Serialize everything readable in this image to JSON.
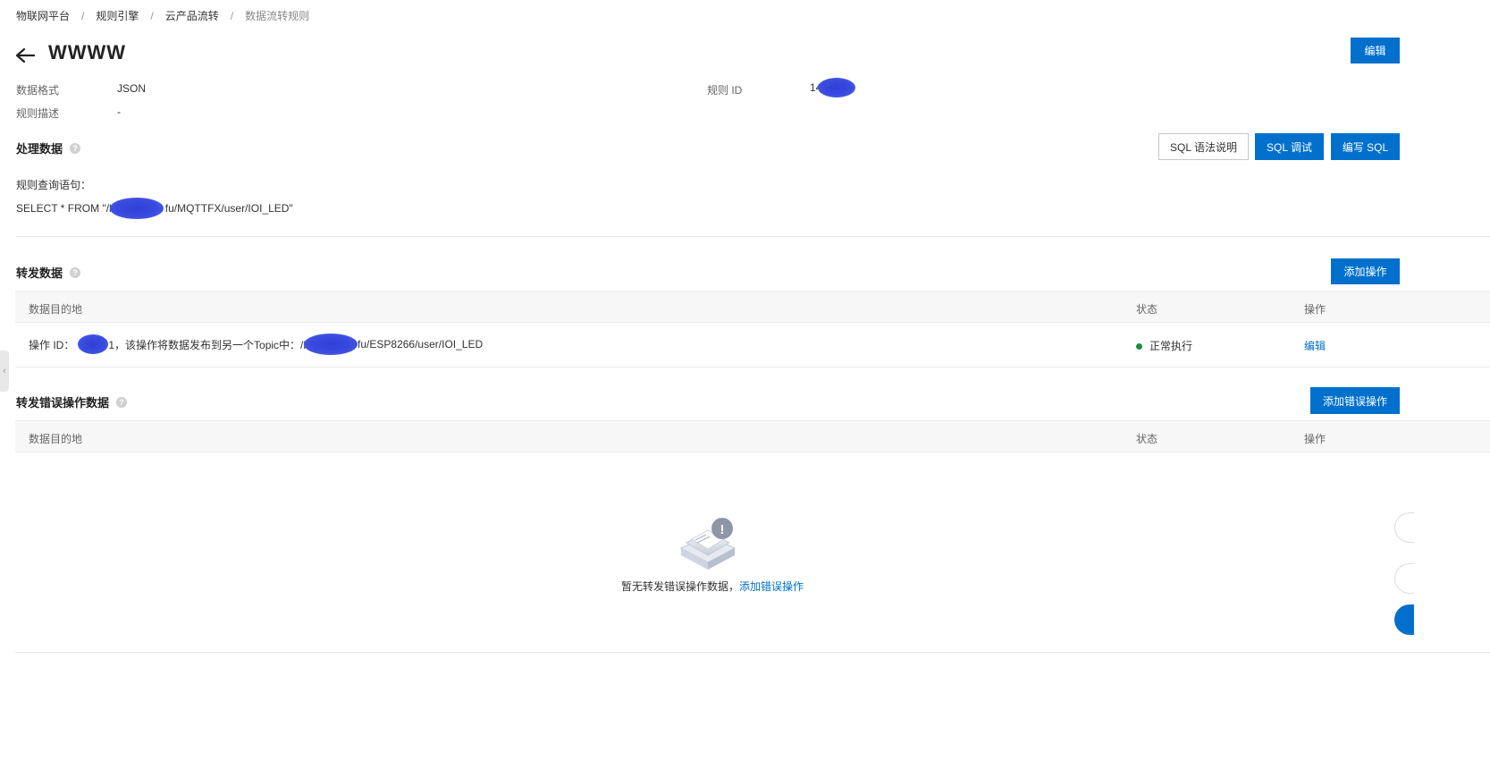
{
  "breadcrumb": [
    "物联网平台",
    "规则引擎",
    "云产品流转",
    "数据流转规则"
  ],
  "breadcrumb_sep": "/",
  "title": "WWWW",
  "edit_button": "编辑",
  "meta": {
    "format_label": "数据格式",
    "format_value": "JSON",
    "desc_label": "规则描述",
    "desc_value": "-",
    "id_label": "规则 ID",
    "id_value_prefix": "14"
  },
  "process": {
    "title": "处理数据",
    "help": "?",
    "sql_help_button": "SQL 语法说明",
    "sql_debug_button": "SQL 调试",
    "sql_write_button": "编写 SQL",
    "query_label": "规则查询语句：",
    "query_prefix": "SELECT * FROM \"/h",
    "query_suffix": "fu/MQTTFX/user/IOI_LED\""
  },
  "forward": {
    "title": "转发数据",
    "help": "?",
    "add_button": "添加操作",
    "columns": [
      "数据目的地",
      "状态",
      "操作"
    ],
    "rows": [
      {
        "dest_prefix": "操作 ID：",
        "dest_middle": "1，该操作将数据发布到另一个Topic中：/h",
        "dest_suffix": "fu/ESP8266/user/IOI_LED",
        "status": "正常执行",
        "action": "编辑"
      }
    ]
  },
  "error_forward": {
    "title": "转发错误操作数据",
    "help": "?",
    "add_button": "添加错误操作",
    "columns": [
      "数据目的地",
      "状态",
      "操作"
    ],
    "empty_text": "暂无转发错误操作数据，",
    "empty_link": "添加错误操作",
    "empty_icon_mark": "!"
  },
  "side_tab_glyph": "‹",
  "colors": {
    "primary": "#0070cc",
    "success": "#1e8e3e",
    "redaction": "#3a4be0"
  }
}
